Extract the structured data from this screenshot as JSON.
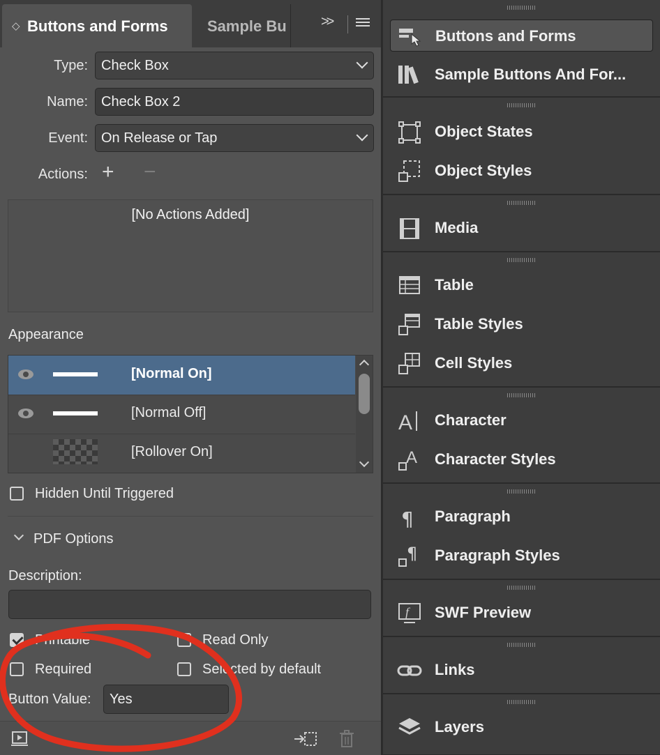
{
  "panel": {
    "active_tab": "Buttons and Forms",
    "inactive_tab": "Sample Bu",
    "more_glyph": ">>"
  },
  "form": {
    "type_label": "Type:",
    "type_value": "Check Box",
    "name_label": "Name:",
    "name_value": "Check Box 2",
    "event_label": "Event:",
    "event_value": "On Release or Tap",
    "actions_label": "Actions:",
    "add_glyph": "+",
    "remove_glyph": "−",
    "no_actions": "[No Actions Added]"
  },
  "appearance": {
    "heading": "Appearance",
    "states": [
      {
        "label": "[Normal On]",
        "selected": true
      },
      {
        "label": "[Normal Off]",
        "selected": false
      },
      {
        "label": "[Rollover On]",
        "selected": false
      }
    ]
  },
  "hidden_until_triggered": {
    "label": "Hidden Until Triggered",
    "checked": false
  },
  "pdf": {
    "section": "PDF Options",
    "description_label": "Description:",
    "description_value": "",
    "printable": {
      "label": "Printable",
      "checked": true
    },
    "read_only": {
      "label": "Read Only",
      "checked": false
    },
    "required": {
      "label": "Required",
      "checked": false
    },
    "selected_default": {
      "label": "Selected by default",
      "checked": false
    },
    "button_value_label": "Button Value:",
    "button_value": "Yes"
  },
  "dock": {
    "groups": [
      {
        "items": [
          {
            "label": "Buttons and Forms",
            "icon": "buttons-forms-icon",
            "active": true
          },
          {
            "label": "Sample Buttons And For...",
            "icon": "sample-buttons-icon",
            "active": false
          }
        ]
      },
      {
        "items": [
          {
            "label": "Object States",
            "icon": "object-states-icon",
            "active": false
          },
          {
            "label": "Object Styles",
            "icon": "object-styles-icon",
            "active": false
          }
        ]
      },
      {
        "items": [
          {
            "label": "Media",
            "icon": "media-icon",
            "active": false
          }
        ]
      },
      {
        "items": [
          {
            "label": "Table",
            "icon": "table-icon",
            "active": false
          },
          {
            "label": "Table Styles",
            "icon": "table-styles-icon",
            "active": false
          },
          {
            "label": "Cell Styles",
            "icon": "cell-styles-icon",
            "active": false
          }
        ]
      },
      {
        "items": [
          {
            "label": "Character",
            "icon": "character-icon",
            "active": false
          },
          {
            "label": "Character Styles",
            "icon": "character-styles-icon",
            "active": false
          }
        ]
      },
      {
        "items": [
          {
            "label": "Paragraph",
            "icon": "paragraph-icon",
            "active": false
          },
          {
            "label": "Paragraph Styles",
            "icon": "paragraph-styles-icon",
            "active": false
          }
        ]
      },
      {
        "items": [
          {
            "label": "SWF Preview",
            "icon": "swf-preview-icon",
            "active": false
          }
        ]
      },
      {
        "items": [
          {
            "label": "Links",
            "icon": "links-icon",
            "active": false
          }
        ]
      },
      {
        "items": [
          {
            "label": "Layers",
            "icon": "layers-icon",
            "active": false
          }
        ]
      }
    ]
  },
  "colors": {
    "panel_bg": "#535353",
    "dock_bg": "#3d3d3d",
    "selection": "#4c6b8c",
    "annotation": "#e0301e"
  }
}
